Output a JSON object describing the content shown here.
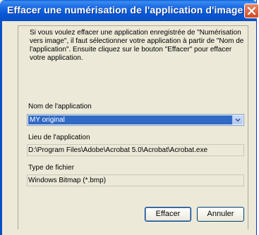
{
  "window": {
    "title": "Effacer une numérisation de l'application d'image"
  },
  "description": {
    "lines": [
      "Si vous voulez effacer une application enregistrée de \"Numérisation",
      "vers image\", il faut sélectionner votre application à partir de \"Nom de",
      "l'application\". Ensuite cliquez sur le bouton \"Effacer\" pour effacer",
      "votre application."
    ]
  },
  "app_name": {
    "label": "Nom de l'application",
    "selected": "MY original"
  },
  "app_location": {
    "label": "Lieu de l'application",
    "value": "D:\\Program Files\\Adobe\\Acrobat 5.0\\Acrobat\\Acrobat.exe"
  },
  "file_type": {
    "label": "Type de fichier",
    "value": "Windows Bitmap (*.bmp)"
  },
  "buttons": {
    "delete": "Effacer",
    "cancel": "Annuler"
  }
}
